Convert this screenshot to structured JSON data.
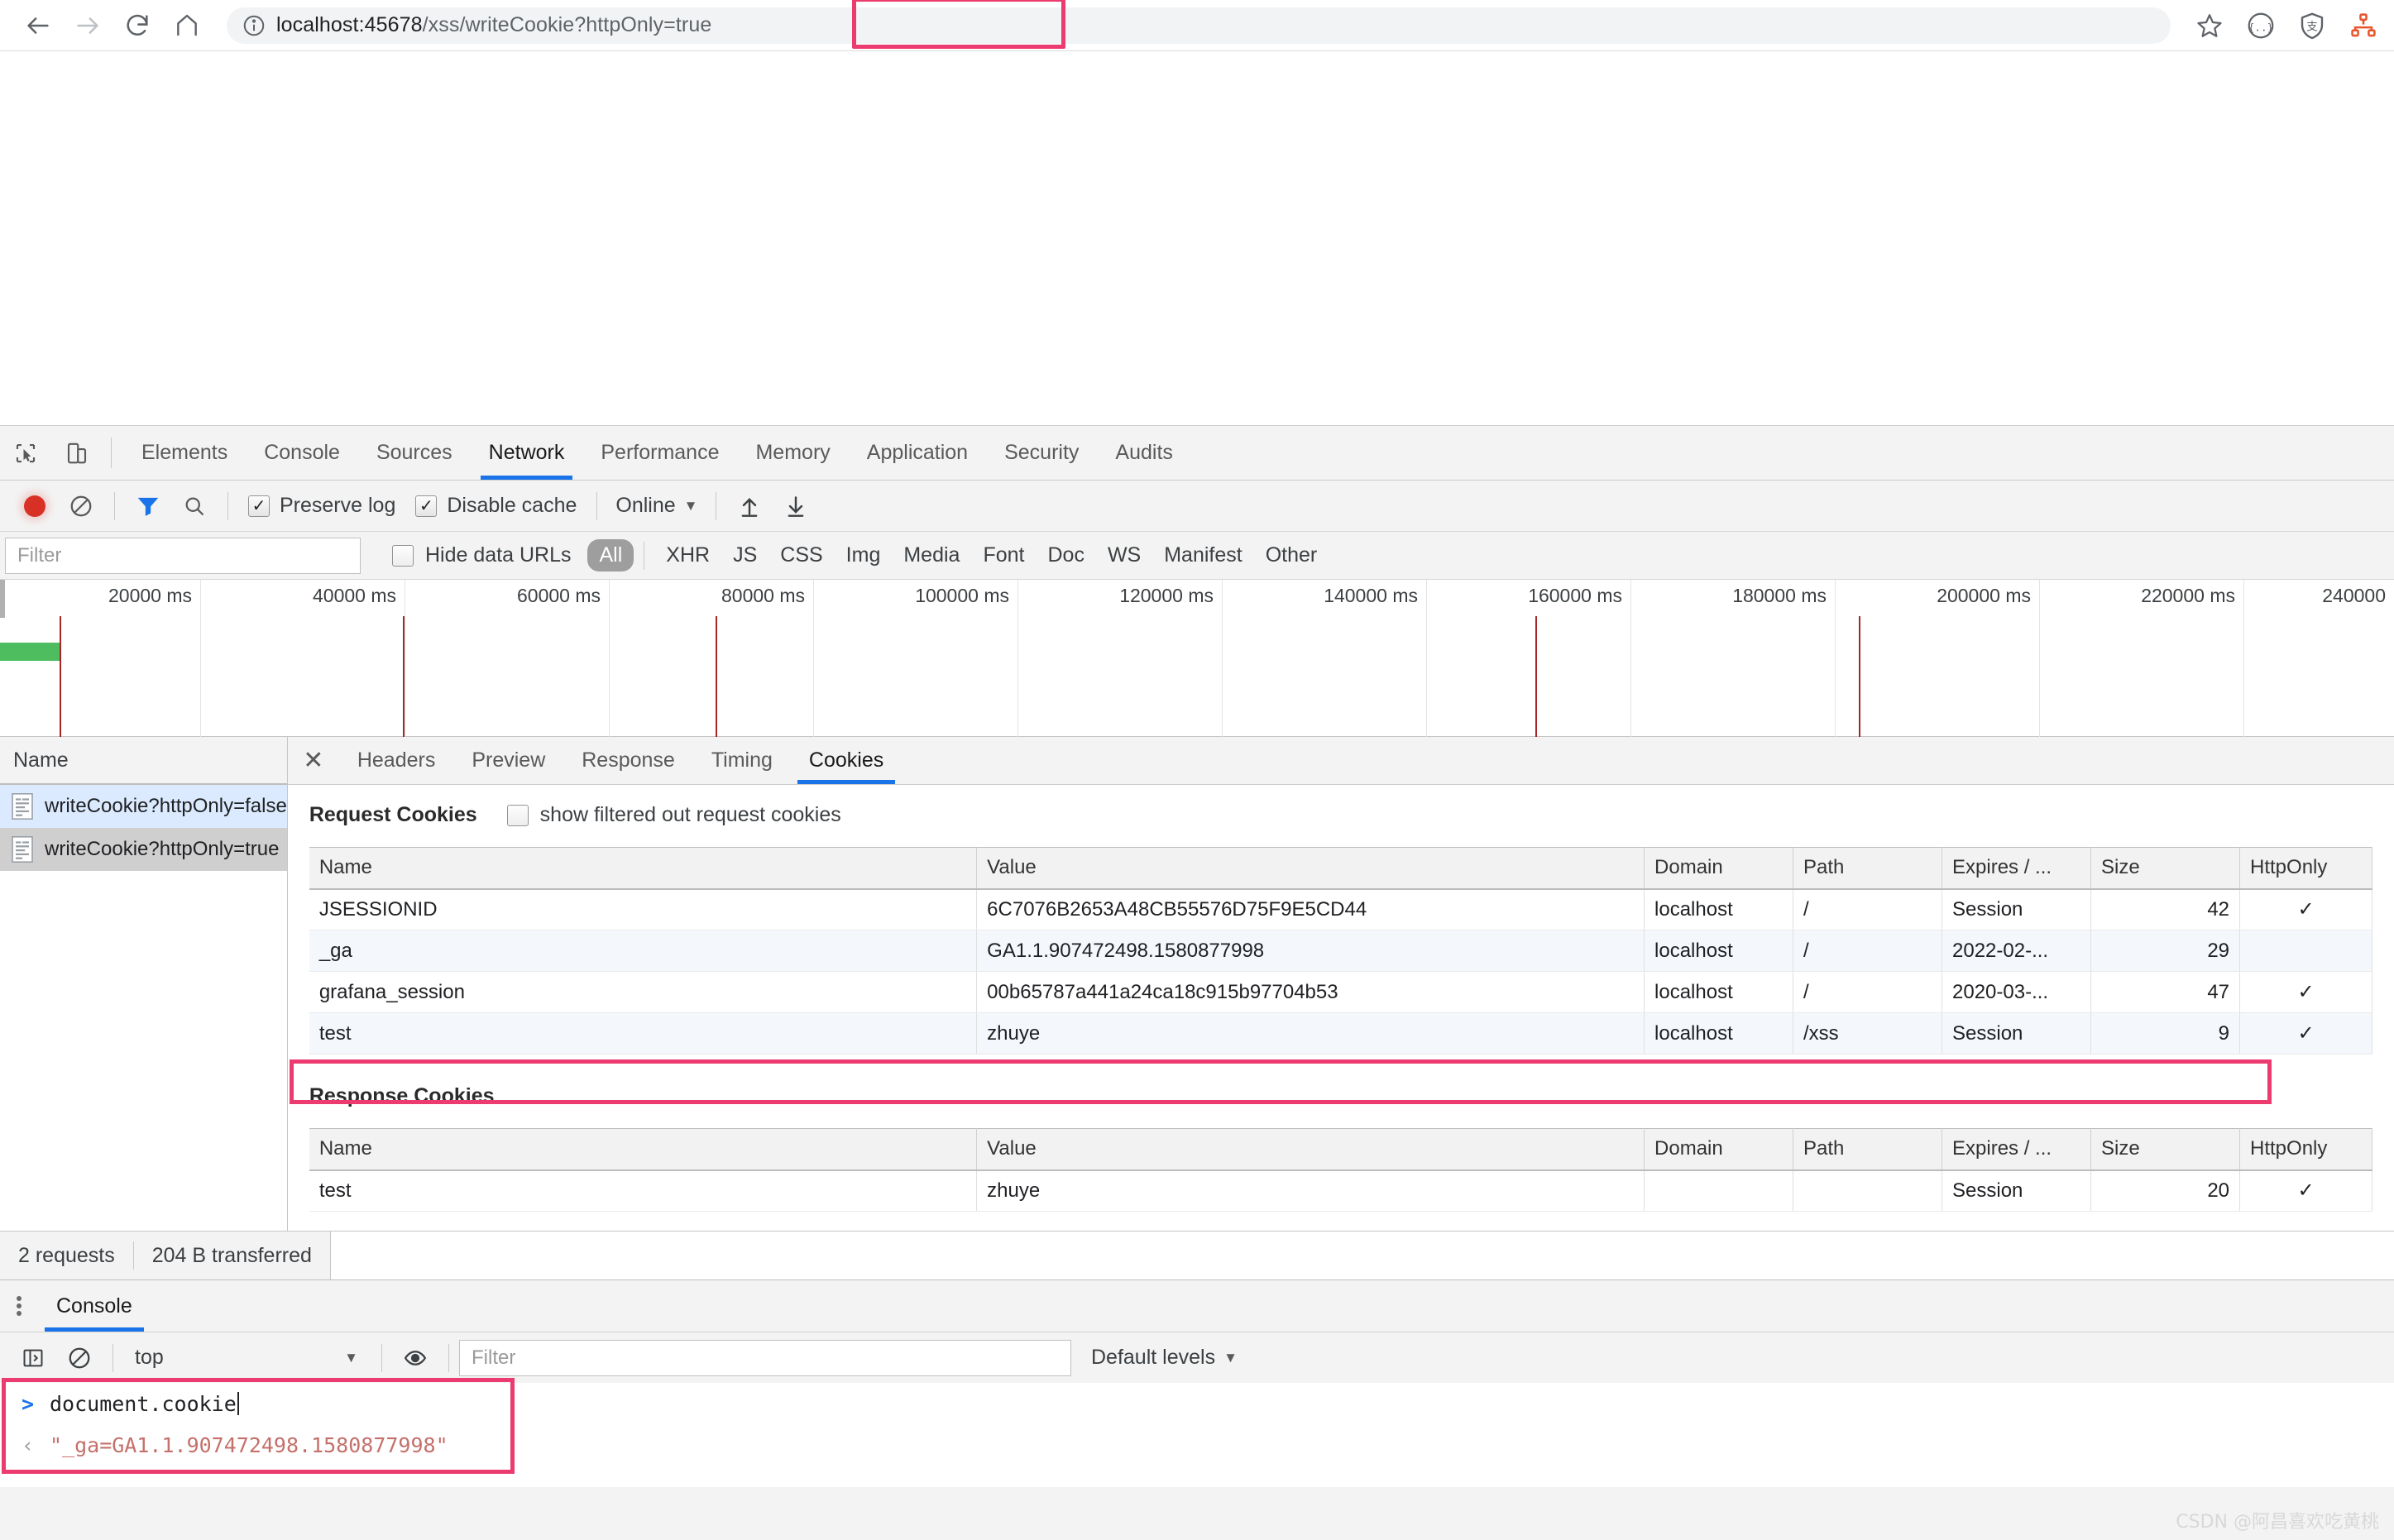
{
  "browser": {
    "nav": {
      "back_label": "Back",
      "forward_label": "Forward",
      "reload_label": "Reload",
      "home_label": "Home"
    },
    "omnibox": {
      "info_icon": "info-circle-icon",
      "url_host": "localhost:45678",
      "url_path": "/xss/writeCookie",
      "url_query": "?httpOnly=true",
      "full_url": "localhost:45678/xss/writeCookie?httpOnly=true",
      "highlight_color": "#ec3b6e"
    },
    "actions": [
      {
        "name": "bookmark-star-icon",
        "label": "Bookmark this page"
      },
      {
        "name": "json-viewer-icon",
        "label": "JSON Viewer"
      },
      {
        "name": "alipay-shield-icon",
        "label": "Alipay Security"
      },
      {
        "name": "sitemap-extension-icon",
        "label": "Extension"
      }
    ]
  },
  "devtools": {
    "tools": [
      {
        "name": "inspect-element-icon",
        "label": "Inspect element"
      },
      {
        "name": "device-toolbar-icon",
        "label": "Toggle device toolbar"
      }
    ],
    "tabs": [
      {
        "label": "Elements",
        "active": false
      },
      {
        "label": "Console",
        "active": false
      },
      {
        "label": "Sources",
        "active": false
      },
      {
        "label": "Network",
        "active": true
      },
      {
        "label": "Performance",
        "active": false
      },
      {
        "label": "Memory",
        "active": false
      },
      {
        "label": "Application",
        "active": false
      },
      {
        "label": "Security",
        "active": false
      },
      {
        "label": "Audits",
        "active": false
      }
    ],
    "network_toolbar": {
      "record_label": "Stop recording network log",
      "clear_label": "Clear",
      "filter_toggle_label": "Filter",
      "search_label": "Search",
      "preserve_log_label": "Preserve log",
      "preserve_log_checked": true,
      "disable_cache_label": "Disable cache",
      "disable_cache_checked": true,
      "throttle_value": "Online",
      "import_label": "Import HAR file",
      "export_label": "Export HAR file",
      "accent_color": "#1a73e8",
      "record_color": "#d93025"
    },
    "filter_bar": {
      "filter_placeholder": "Filter",
      "filter_value": "",
      "hide_data_urls_label": "Hide data URLs",
      "hide_data_urls_checked": false,
      "types": [
        {
          "label": "All",
          "active": true
        },
        {
          "label": "XHR",
          "active": false
        },
        {
          "label": "JS",
          "active": false
        },
        {
          "label": "CSS",
          "active": false
        },
        {
          "label": "Img",
          "active": false
        },
        {
          "label": "Media",
          "active": false
        },
        {
          "label": "Font",
          "active": false
        },
        {
          "label": "Doc",
          "active": false
        },
        {
          "label": "WS",
          "active": false
        },
        {
          "label": "Manifest",
          "active": false
        },
        {
          "label": "Other",
          "active": false
        }
      ]
    },
    "overview": {
      "ticks": [
        "20000 ms",
        "40000 ms",
        "60000 ms",
        "80000 ms",
        "100000 ms",
        "120000 ms",
        "140000 ms",
        "160000 ms",
        "180000 ms",
        "200000 ms",
        "220000 ms",
        "240000"
      ],
      "bar_color": "#4dbd60",
      "event_line_color": "#a52727"
    },
    "request_list": {
      "column_header": "Name",
      "rows": [
        {
          "name": "writeCookie?httpOnly=false",
          "selected": "blue"
        },
        {
          "name": "writeCookie?httpOnly=true",
          "selected": "gray"
        }
      ]
    },
    "details": {
      "close_label": "×",
      "tabs": [
        {
          "label": "Headers",
          "active": false
        },
        {
          "label": "Preview",
          "active": false
        },
        {
          "label": "Response",
          "active": false
        },
        {
          "label": "Timing",
          "active": false
        },
        {
          "label": "Cookies",
          "active": true
        }
      ],
      "request_cookies": {
        "title": "Request Cookies",
        "checkbox_label": "show filtered out request cookies",
        "checkbox_checked": false,
        "columns": [
          "Name",
          "Value",
          "Domain",
          "Path",
          "Expires / ...",
          "Size",
          "HttpOnly"
        ],
        "rows": [
          {
            "name": "JSESSIONID",
            "value": "6C7076B2653A48CB55576D75F9E5CD44",
            "domain": "localhost",
            "path": "/",
            "expires": "Session",
            "size": "42",
            "httponly": "✓",
            "highlight": false
          },
          {
            "name": "_ga",
            "value": "GA1.1.907472498.1580877998",
            "domain": "localhost",
            "path": "/",
            "expires": "2022-02-...",
            "size": "29",
            "httponly": "",
            "highlight": false
          },
          {
            "name": "grafana_session",
            "value": "00b65787a441a24ca18c915b97704b53",
            "domain": "localhost",
            "path": "/",
            "expires": "2020-03-...",
            "size": "47",
            "httponly": "✓",
            "highlight": false
          },
          {
            "name": "test",
            "value": "zhuye",
            "domain": "localhost",
            "path": "/xss",
            "expires": "Session",
            "size": "9",
            "httponly": "✓",
            "highlight": true
          }
        ]
      },
      "response_cookies": {
        "title": "Response Cookies",
        "columns": [
          "Name",
          "Value",
          "Domain",
          "Path",
          "Expires / ...",
          "Size",
          "HttpOnly"
        ],
        "rows": [
          {
            "name": "test",
            "value": "zhuye",
            "domain": "",
            "path": "",
            "expires": "Session",
            "size": "20",
            "httponly": "✓",
            "highlight": false
          }
        ]
      }
    },
    "status_bar": {
      "requests": "2 requests",
      "transferred": "204 B transferred"
    },
    "drawer": {
      "more_label": "More tools",
      "tabs": [
        {
          "label": "Console",
          "active": true
        }
      ],
      "toolbar": {
        "sidebar_toggle_label": "Show console sidebar",
        "clear_label": "Clear console",
        "context_value": "top",
        "eye_label": "Create live expression",
        "filter_placeholder": "Filter",
        "filter_value": "",
        "levels_label": "Default levels"
      },
      "output": {
        "input_prompt": ">",
        "input_text": "document.cookie",
        "result_prompt": "‹",
        "result_text": "\"_ga=GA1.1.907472498.1580877998\"",
        "result_color": "#c5706b",
        "highlight_color": "#ec3b6e"
      }
    }
  },
  "watermark": "CSDN @阿昌喜欢吃黄桃"
}
